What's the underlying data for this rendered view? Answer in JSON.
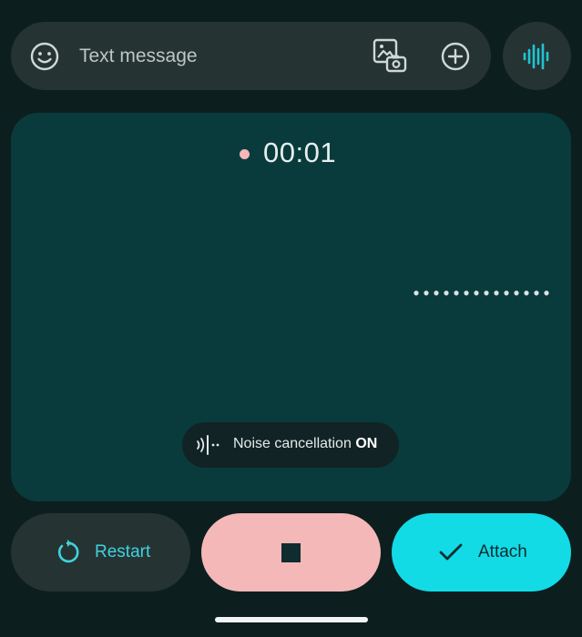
{
  "compose": {
    "placeholder": "Text message",
    "emoji_icon": "smiley-face-icon",
    "gallery_icon": "gallery-camera-icon",
    "add_icon": "plus-circle-icon",
    "voice_icon": "audio-waveform-icon"
  },
  "recording": {
    "status_dot_color": "#f5b8b8",
    "timer": "00:01",
    "waveform_icon": "waveform-dots",
    "noise_cancellation": {
      "icon": "noise-cancellation-icon",
      "label": "Noise cancellation",
      "state": "ON"
    }
  },
  "actions": {
    "restart": {
      "label": "Restart",
      "icon": "restart-icon"
    },
    "stop": {
      "icon": "stop-icon"
    },
    "attach": {
      "label": "Attach",
      "icon": "checkmark-icon"
    }
  },
  "colors": {
    "background": "#0d1e1e",
    "panel": "#0a3b3c",
    "surface": "#263333",
    "accent": "#12dbe6",
    "stop": "#f4b8b8"
  }
}
